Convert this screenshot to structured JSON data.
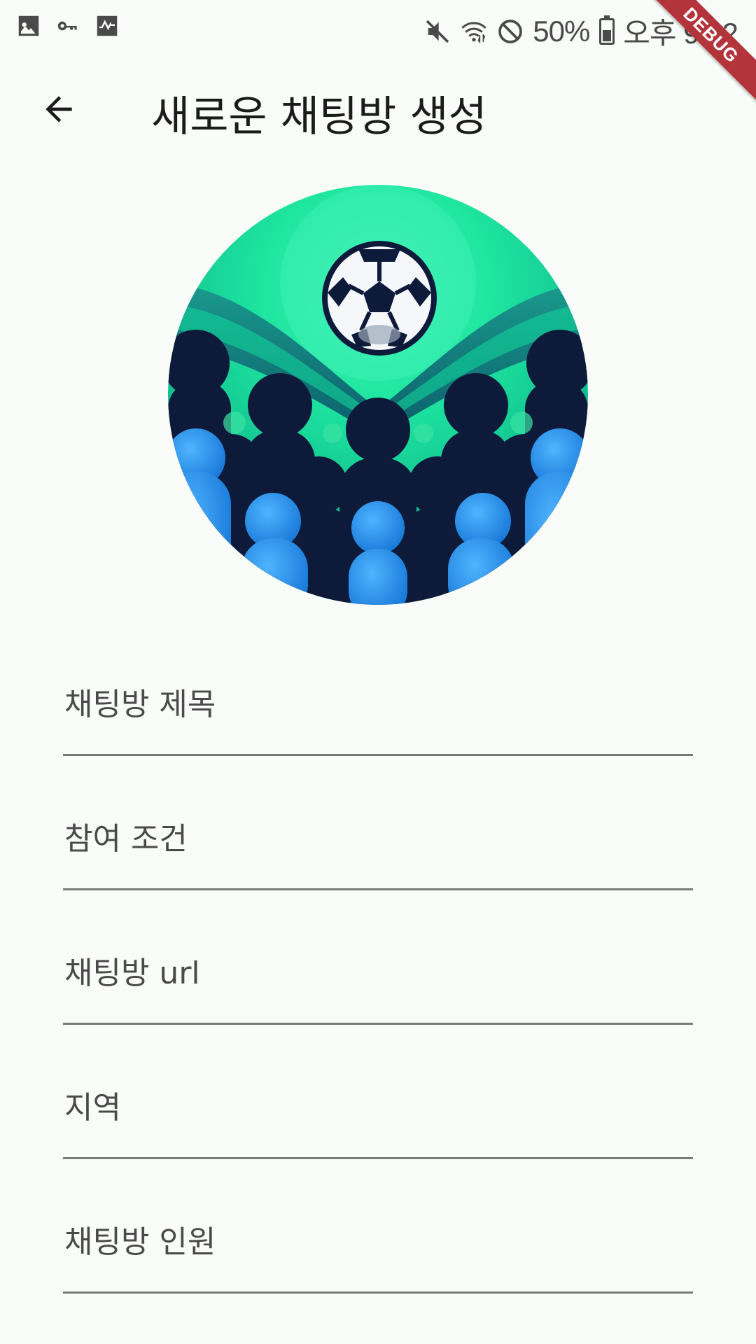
{
  "status_bar": {
    "battery": "50%",
    "time": "오후 9:22",
    "battery_level": 0.5
  },
  "debug_banner": "DEBUG",
  "app_bar": {
    "title": "새로운 채팅방 생성",
    "back_icon": "arrow-back-icon"
  },
  "avatar": {
    "description_icon": "soccer-crowd-image"
  },
  "form": {
    "fields": [
      {
        "label": "채팅방 제목"
      },
      {
        "label": "참여 조건"
      },
      {
        "label": "채팅방 url"
      },
      {
        "label": "지역"
      },
      {
        "label": "채팅방 인원"
      }
    ]
  },
  "colors": {
    "background": "#fafcf9",
    "underline": "#7a7a7a",
    "debug": "#b3343a",
    "green": "#1ee6a0",
    "navy": "#0e1a3a",
    "blue": "#2a8ee8"
  }
}
